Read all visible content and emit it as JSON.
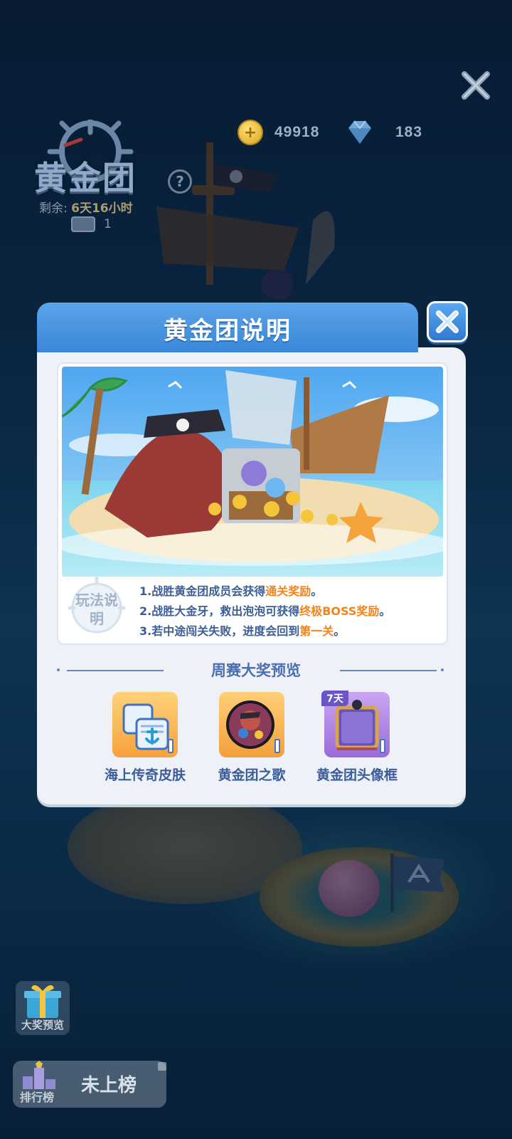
{
  "hud": {
    "coins": "49918",
    "gems": "183",
    "logo_text": "黄金团",
    "help_label": "?",
    "remaining_label": "剩余:",
    "remaining_value": "6天16小时",
    "ticket_count": "1"
  },
  "modal": {
    "title": "黄金团说明",
    "rules_badge": "玩法说明",
    "rules": [
      {
        "prefix": "1.战胜黄金团成员会获得",
        "highlight": "通关奖励",
        "suffix": "。"
      },
      {
        "prefix": "2.战胜大金牙，救出泡泡可获得",
        "highlight": "终极BOSS奖励",
        "suffix": "。"
      },
      {
        "prefix": "3.若中途闯关失败，进度会回到",
        "highlight": "第一关",
        "suffix": "。"
      }
    ],
    "section_title": "周赛大奖预览",
    "rewards": [
      {
        "label": "海上传奇皮肤",
        "icon": "anchor-skin-icon"
      },
      {
        "label": "黄金团之歌",
        "icon": "pirate-record-icon"
      },
      {
        "label": "黄金团头像框",
        "icon": "avatar-frame-icon",
        "tag": "7天"
      }
    ]
  },
  "bottom": {
    "prize_preview_label": "大奖预览",
    "leaderboard_label": "排行榜",
    "leaderboard_status": "未上榜"
  },
  "colors": {
    "header_blue": "#3b86d7",
    "rule_text": "#3c5d96",
    "highlight_orange": "#f0841d"
  }
}
